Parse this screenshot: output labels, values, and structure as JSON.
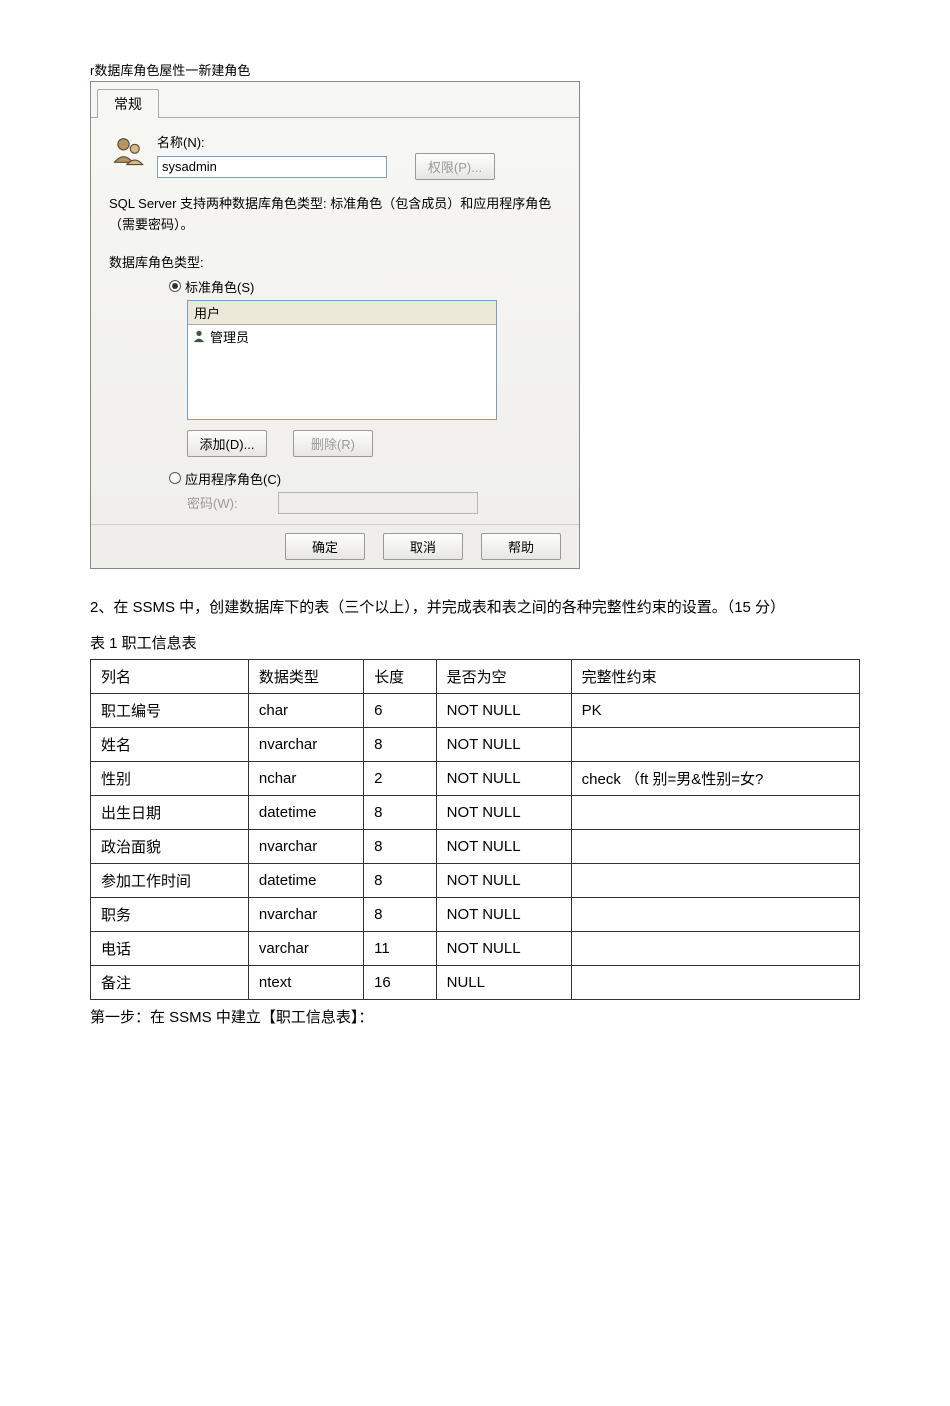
{
  "window_title": "r数据库角色屋性一新建角色",
  "dialog": {
    "tab_label": "常规",
    "name_label": "名称(N):",
    "name_value": "sysadmin",
    "permissions_btn": "权限(P)...",
    "info": "SQL Server 支持两种数据库角色类型: 标准角色（包含成员）和应用程序角色（需要密码）。",
    "group_label": "数据库角色类型:",
    "radio_standard": "标准角色(S)",
    "radio_app": "应用程序角色(C)",
    "list_header": "用户",
    "list_item1": "管理员",
    "add_btn": "添加(D)...",
    "delete_btn": "删除(R)",
    "pwd_label": "密码(W):",
    "ok": "确定",
    "cancel": "取消",
    "help": "帮助"
  },
  "doc": {
    "paragraph": "2、在 SSMS 中，创建数据库下的表（三个以上），并完成表和表之间的各种完整性约束的设置。（15 分）",
    "table_caption": "表 1 职工信息表",
    "headers": {
      "col": "列名",
      "type": "数据类型",
      "len": "长度",
      "null": "是否为空",
      "constraint": "完整性约束"
    },
    "rows": [
      {
        "col": "职工编号",
        "type": "char",
        "len": "6",
        "null": "NOT NULL",
        "constraint": "PK"
      },
      {
        "col": "姓名",
        "type": "nvarchar",
        "len": "8",
        "null": "NOT NULL",
        "constraint": ""
      },
      {
        "col": "性别",
        "type": "nchar",
        "len": "2",
        "null": "NOT NULL",
        "constraint": "check （ft 别=男&性别=女?"
      },
      {
        "col": "出生日期",
        "type": "datetime",
        "len": "8",
        "null": "NOT NULL",
        "constraint": ""
      },
      {
        "col": "政治面貌",
        "type": "nvarchar",
        "len": "8",
        "null": "NOT NULL",
        "constraint": ""
      },
      {
        "col": "参加工作时间",
        "type": "datetime",
        "len": "8",
        "null": "NOT NULL",
        "constraint": ""
      },
      {
        "col": "职务",
        "type": "nvarchar",
        "len": "8",
        "null": "NOT NULL",
        "constraint": ""
      },
      {
        "col": "电话",
        "type": "varchar",
        "len": "11",
        "null": "NOT NULL",
        "constraint": ""
      },
      {
        "col": "备注",
        "type": "ntext",
        "len": "16",
        "null": "NULL",
        "constraint": ""
      }
    ],
    "step": "第一步：在 SSMS 中建立【职工信息表】："
  }
}
